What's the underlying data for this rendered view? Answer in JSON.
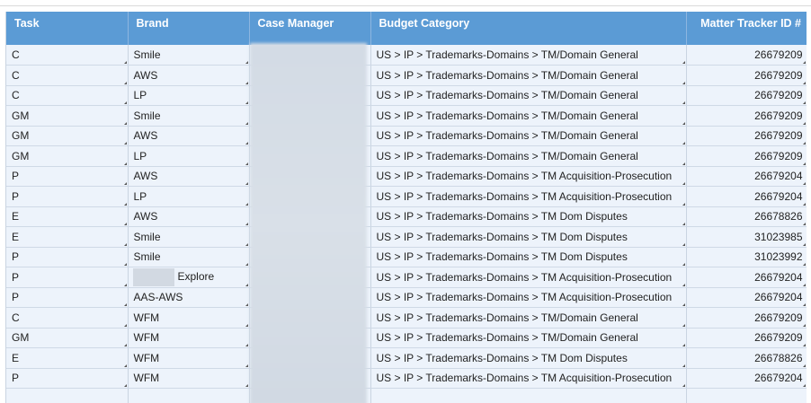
{
  "table": {
    "columns": [
      "Task",
      "Brand",
      "Case Manager",
      "Budget Category",
      "Matter Tracker ID #"
    ],
    "rows": [
      {
        "task": "C",
        "brand": "Smile",
        "budget": "US > IP > Trademarks-Domains > TM/Domain General",
        "tracker": "26679209"
      },
      {
        "task": "C",
        "brand": "AWS",
        "budget": "US > IP > Trademarks-Domains > TM/Domain General",
        "tracker": "26679209"
      },
      {
        "task": "C",
        "brand": "LP",
        "budget": "US > IP > Trademarks-Domains > TM/Domain General",
        "tracker": "26679209"
      },
      {
        "task": "GM",
        "brand": "Smile",
        "budget": "US > IP > Trademarks-Domains > TM/Domain General",
        "tracker": "26679209"
      },
      {
        "task": "GM",
        "brand": "AWS",
        "budget": "US > IP > Trademarks-Domains > TM/Domain General",
        "tracker": "26679209"
      },
      {
        "task": "GM",
        "brand": "LP",
        "budget": "US > IP > Trademarks-Domains > TM/Domain General",
        "tracker": "26679209"
      },
      {
        "task": "P",
        "brand": "AWS",
        "budget": "US > IP > Trademarks-Domains > TM Acquisition-Prosecution",
        "tracker": "26679204"
      },
      {
        "task": "P",
        "brand": "LP",
        "budget": "US > IP > Trademarks-Domains > TM Acquisition-Prosecution",
        "tracker": "26679204"
      },
      {
        "task": "E",
        "brand": "AWS",
        "budget": "US > IP > Trademarks-Domains > TM Dom Disputes",
        "tracker": "26678826"
      },
      {
        "task": "E",
        "brand": "Smile",
        "budget": "US > IP > Trademarks-Domains > TM Dom Disputes",
        "tracker": "31023985"
      },
      {
        "task": "P",
        "brand": "Smile",
        "budget": "US > IP > Trademarks-Domains > TM Dom Disputes",
        "tracker": "31023992"
      },
      {
        "task": "P",
        "brand": "Explore",
        "budget": "US > IP > Trademarks-Domains > TM Acquisition-Prosecution",
        "tracker": "26679204"
      },
      {
        "task": "P",
        "brand": "AAS-AWS",
        "budget": "US > IP > Trademarks-Domains > TM Acquisition-Prosecution",
        "tracker": "26679204"
      },
      {
        "task": "C",
        "brand": "WFM",
        "budget": "US > IP > Trademarks-Domains > TM/Domain General",
        "tracker": "26679209"
      },
      {
        "task": "GM",
        "brand": "WFM",
        "budget": "US > IP > Trademarks-Domains > TM/Domain General",
        "tracker": "26679209"
      },
      {
        "task": "E",
        "brand": "WFM",
        "budget": "US > IP > Trademarks-Domains > TM Dom Disputes",
        "tracker": "26678826"
      },
      {
        "task": "P",
        "brand": "WFM",
        "budget": "US > IP > Trademarks-Domains > TM Acquisition-Prosecution",
        "tracker": "26679204"
      }
    ]
  },
  "colors": {
    "header_bg": "#5b9bd5",
    "header_text": "#ffffff",
    "row_bg": "#edf3fb"
  }
}
